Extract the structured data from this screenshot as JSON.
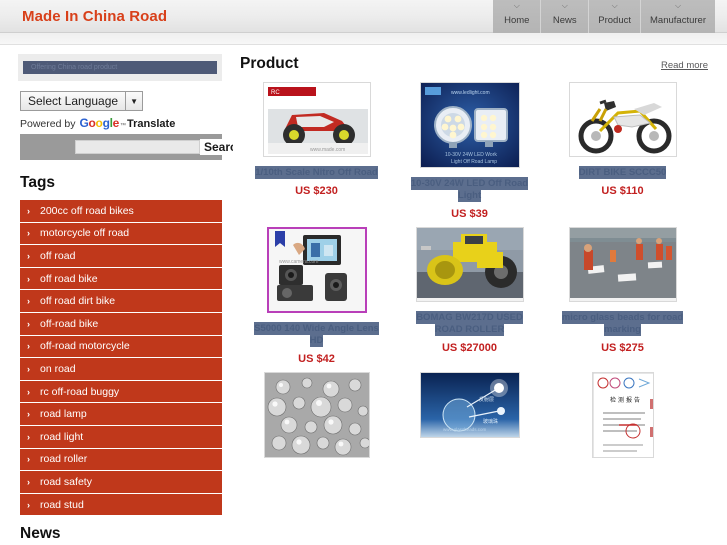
{
  "header": {
    "site_title": "Made In China Road",
    "nav": [
      {
        "label": "Home",
        "icon": "chevron-down-icon"
      },
      {
        "label": "News",
        "icon": "chevron-down-icon"
      },
      {
        "label": "Product",
        "icon": "chevron-down-icon"
      },
      {
        "label": "Manufacturer",
        "icon": "chevron-down-icon"
      }
    ]
  },
  "sidebar": {
    "promo_text": "Offering China road product",
    "language_select": {
      "label": "Select Language",
      "arrow_icon": "chevron-down-icon"
    },
    "powered_by": {
      "prefix": "Powered by",
      "brand_letters": [
        "G",
        "o",
        "o",
        "g",
        "l",
        "e"
      ],
      "trademark": "™",
      "suffix": "Translate"
    },
    "search": {
      "value": "",
      "placeholder": "",
      "button_label": "Search"
    },
    "tags_title": "Tags",
    "tags": [
      {
        "label": "200cc off road bikes",
        "icon": "chevron-right-icon"
      },
      {
        "label": "motorcycle off road",
        "icon": "chevron-right-icon"
      },
      {
        "label": "off road",
        "icon": "chevron-right-icon"
      },
      {
        "label": "off road bike",
        "icon": "chevron-right-icon"
      },
      {
        "label": "off road dirt bike",
        "icon": "chevron-right-icon"
      },
      {
        "label": "off-road bike",
        "icon": "chevron-right-icon"
      },
      {
        "label": "off-road motorcycle",
        "icon": "chevron-right-icon"
      },
      {
        "label": "on road",
        "icon": "chevron-right-icon"
      },
      {
        "label": "rc off-road buggy",
        "icon": "chevron-right-icon"
      },
      {
        "label": "road lamp",
        "icon": "chevron-right-icon"
      },
      {
        "label": "road light",
        "icon": "chevron-right-icon"
      },
      {
        "label": "road roller",
        "icon": "chevron-right-icon"
      },
      {
        "label": "road safety",
        "icon": "chevron-right-icon"
      },
      {
        "label": "road stud",
        "icon": "chevron-right-icon"
      }
    ],
    "news_title": "News"
  },
  "main": {
    "title": "Product",
    "read_more": "Read more",
    "products": [
      {
        "title": "1/10th Scale Nitro Off Road",
        "price": "US $230",
        "image": "rc-monster-truck"
      },
      {
        "title": "10-30V 24W LED Off Road Light",
        "price": "US $39",
        "image": "led-work-lights"
      },
      {
        "title": "DIRT BIKE SCCC50",
        "price": "US $110",
        "image": "dirt-bike"
      },
      {
        "title": "S5000 140 Wide Angle Lens HD",
        "price": "US $42",
        "image": "dash-camera"
      },
      {
        "title": "BOMAG BW217D USED ROAD ROLLER",
        "price": "US $27000",
        "image": "road-roller"
      },
      {
        "title": "micro glass beads for road marking",
        "price": "US $275",
        "image": "road-marking-crew"
      },
      {
        "title": "",
        "price": "",
        "image": "glass-beads-macro"
      },
      {
        "title": "",
        "price": "",
        "image": "blue-tech-graphic"
      },
      {
        "title": "",
        "price": "",
        "image": "certificate-document"
      }
    ]
  },
  "colors": {
    "brand_red": "#d8401a",
    "tag_red": "#c0381b",
    "price_red": "#c22020",
    "selection_blue": "#5c6e8e",
    "header_gray": "#ececec"
  }
}
